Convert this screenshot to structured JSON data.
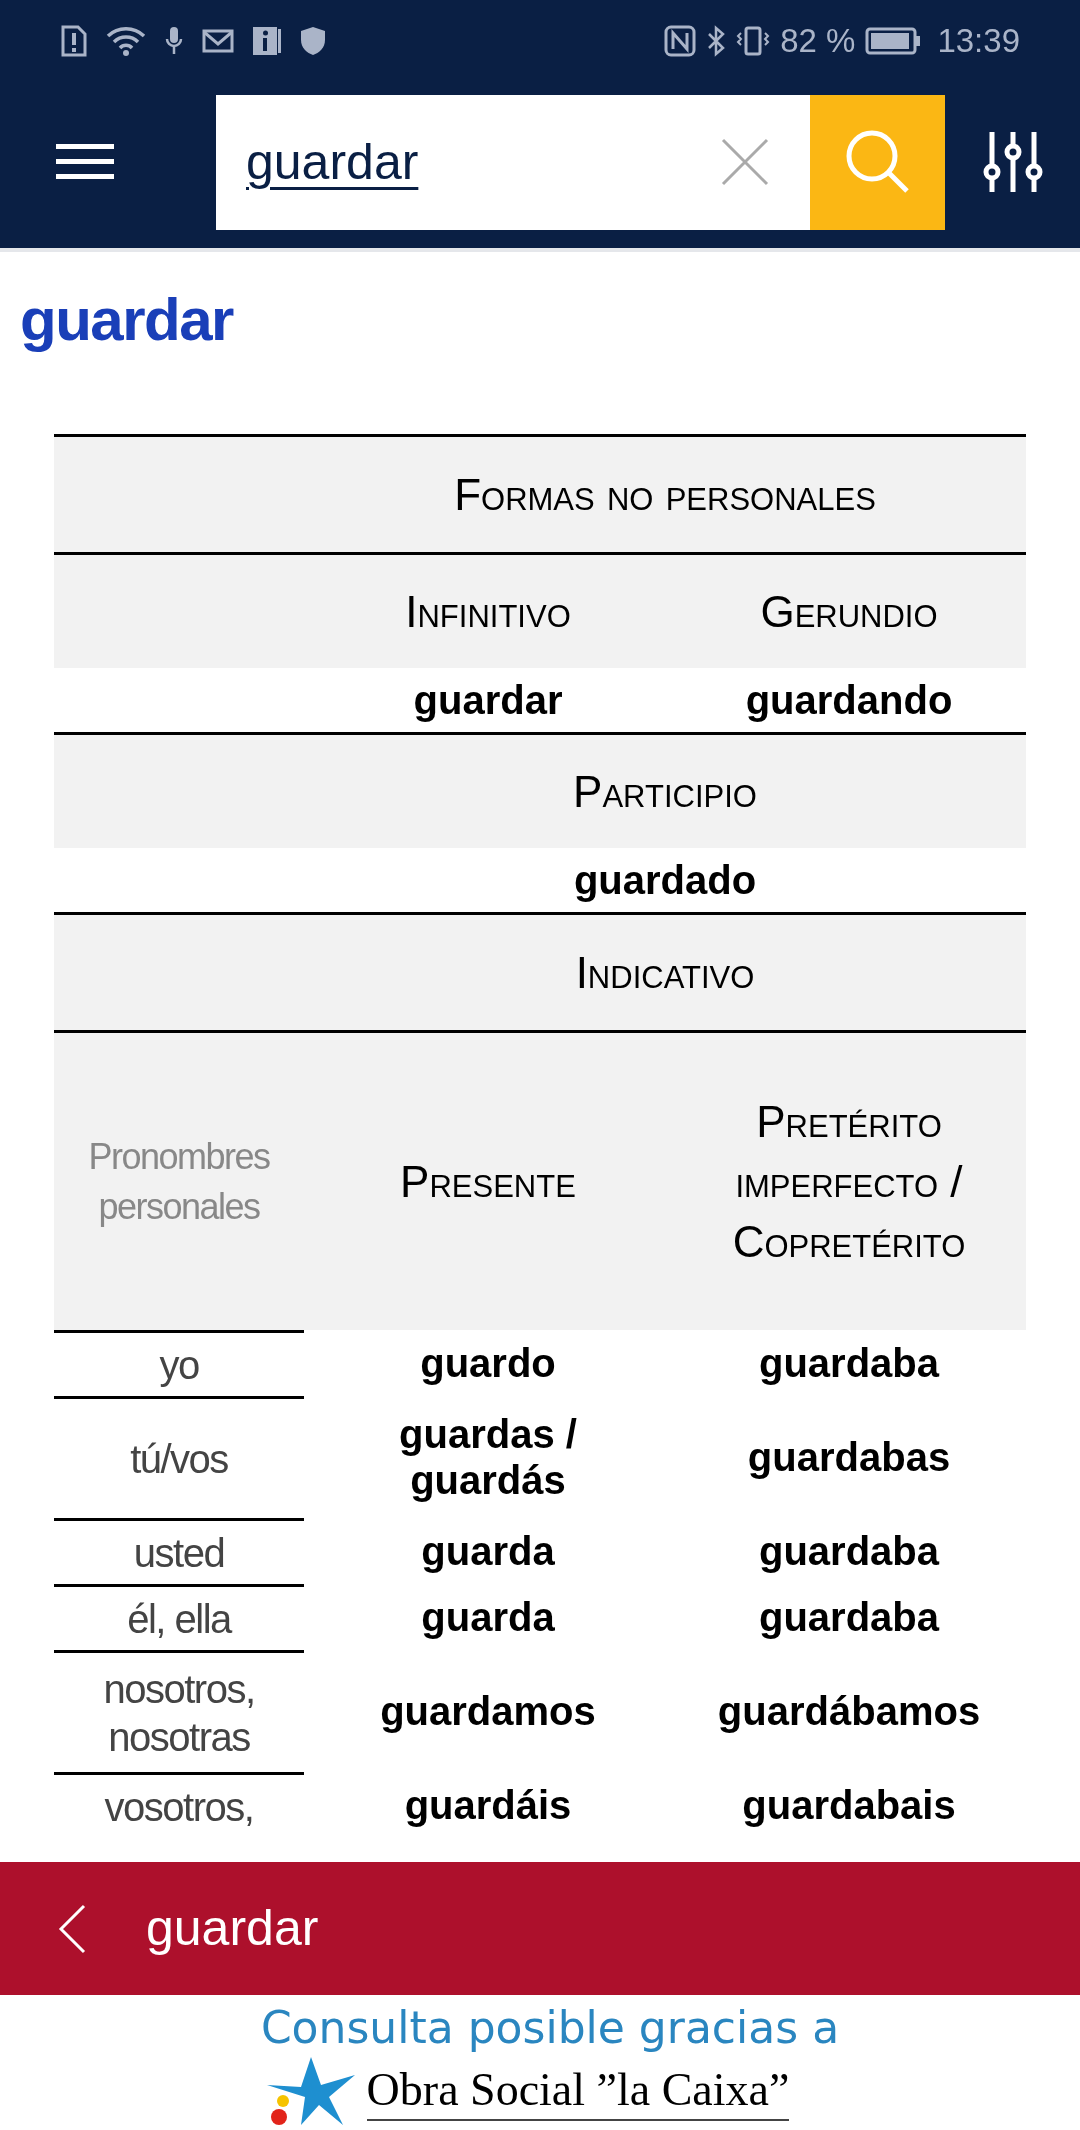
{
  "status_bar": {
    "battery": "82 %",
    "time": "13:39"
  },
  "search": {
    "value": "guardar"
  },
  "entry_title": "guardar",
  "conjugation": {
    "nonpersonal_heading": "Formas no personales",
    "infinitive": {
      "label": "Infinitivo",
      "form": "guardar"
    },
    "gerund": {
      "label": "Gerundio",
      "form": "guardando"
    },
    "participle": {
      "label": "Participio",
      "form": "guardado"
    },
    "mood_heading": "Indicativo",
    "pronoun_heading": "Pronombres personales",
    "tense_columns": [
      "Presente",
      "Pretérito imperfecto / Copretérito"
    ],
    "rows": [
      {
        "pronoun": "yo",
        "forms": [
          "guardo",
          "guardaba"
        ]
      },
      {
        "pronoun": "tú/vos",
        "forms": [
          "guardas / guardás",
          "guardabas"
        ]
      },
      {
        "pronoun": "usted",
        "forms": [
          "guarda",
          "guardaba"
        ]
      },
      {
        "pronoun": "él, ella",
        "forms": [
          "guarda",
          "guardaba"
        ]
      },
      {
        "pronoun": "nosotros, nosotras",
        "forms": [
          "guardamos",
          "guardábamos"
        ]
      },
      {
        "pronoun": "vosotros,",
        "forms": [
          "guardáis",
          "guardabais"
        ]
      }
    ]
  },
  "bottom_bar": {
    "word": "guardar"
  },
  "sponsor": {
    "caption": "Consulta posible gracias a",
    "name": "Obra Social ”la Caixa”"
  }
}
